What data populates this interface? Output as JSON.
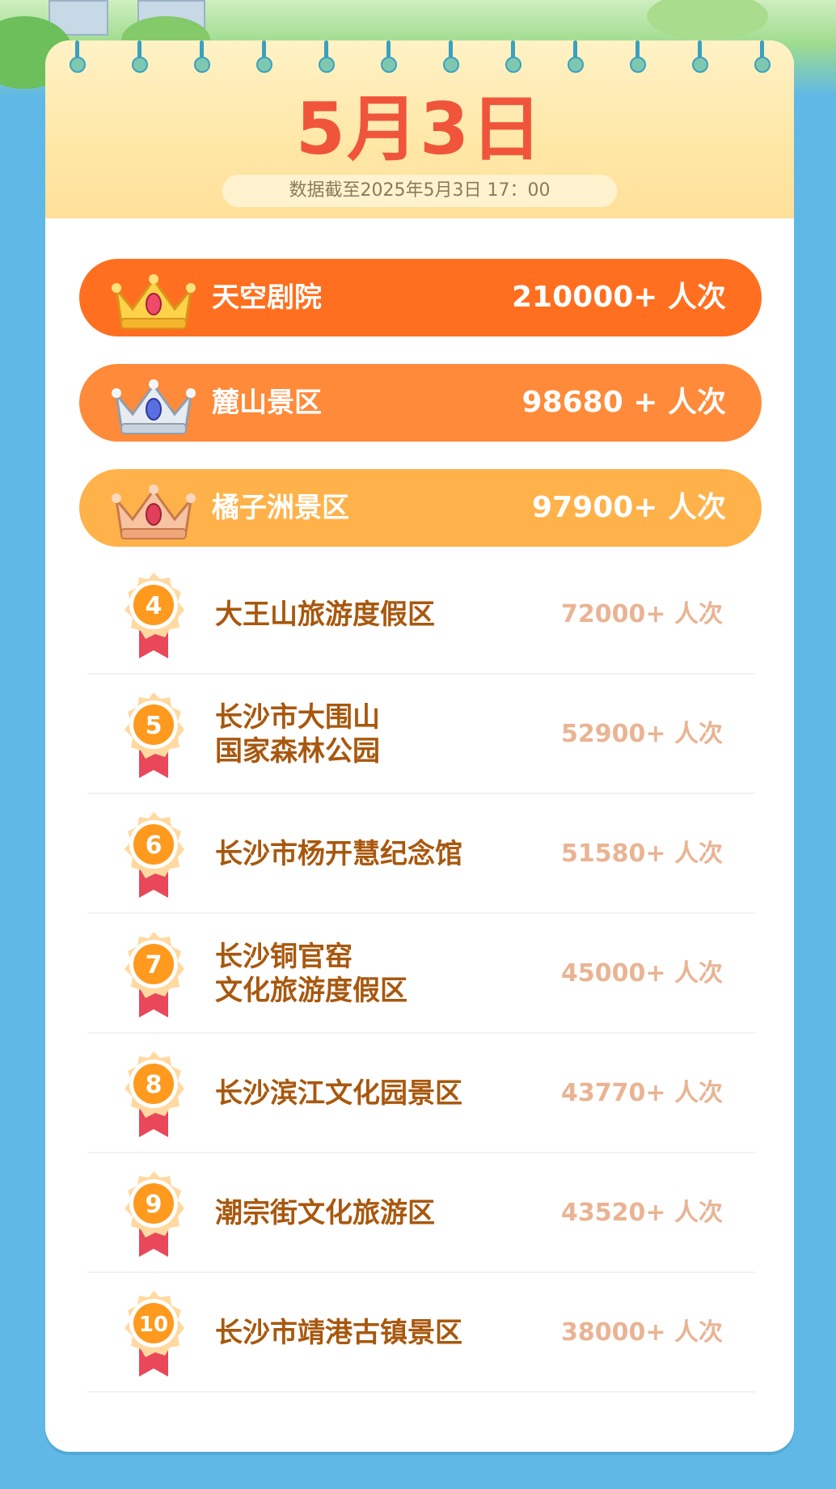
{
  "header": {
    "date_title": "5月3日",
    "data_note": "数据截至2025年5月3日 17：00"
  },
  "colors": {
    "rank1_bg": "#ff6f1f",
    "rank2_bg": "#ff8a3a",
    "rank3_bg": "#ffb24a",
    "rank_text": "#a8580e",
    "count_text": "#e9b494",
    "title_red": "#f0553b",
    "frame_blue": "#5fb8e6"
  },
  "top3": [
    {
      "rank": 1,
      "crown": "gold-crown-icon",
      "name": "天空剧院",
      "count": "210000+ 人次"
    },
    {
      "rank": 2,
      "crown": "silver-crown-icon",
      "name": "麓山景区",
      "count": "98680 + 人次"
    },
    {
      "rank": 3,
      "crown": "bronze-crown-icon",
      "name": "橘子洲景区",
      "count": "97900+ 人次"
    }
  ],
  "ranks": [
    {
      "rank": "4",
      "line1": "大王山旅游度假区",
      "line2": "",
      "count": "72000+ 人次"
    },
    {
      "rank": "5",
      "line1": "长沙市大围山",
      "line2": "国家森林公园",
      "count": "52900+ 人次"
    },
    {
      "rank": "6",
      "line1": "长沙市杨开慧纪念馆",
      "line2": "",
      "count": "51580+ 人次"
    },
    {
      "rank": "7",
      "line1": "长沙铜官窑",
      "line2": "文化旅游度假区",
      "count": "45000+ 人次"
    },
    {
      "rank": "8",
      "line1": "长沙滨江文化园景区",
      "line2": "",
      "count": "43770+ 人次"
    },
    {
      "rank": "9",
      "line1": "潮宗街文化旅游区",
      "line2": "",
      "count": "43520+ 人次"
    },
    {
      "rank": "10",
      "line1": "长沙市靖港古镇景区",
      "line2": "",
      "count": "38000+ 人次"
    }
  ]
}
